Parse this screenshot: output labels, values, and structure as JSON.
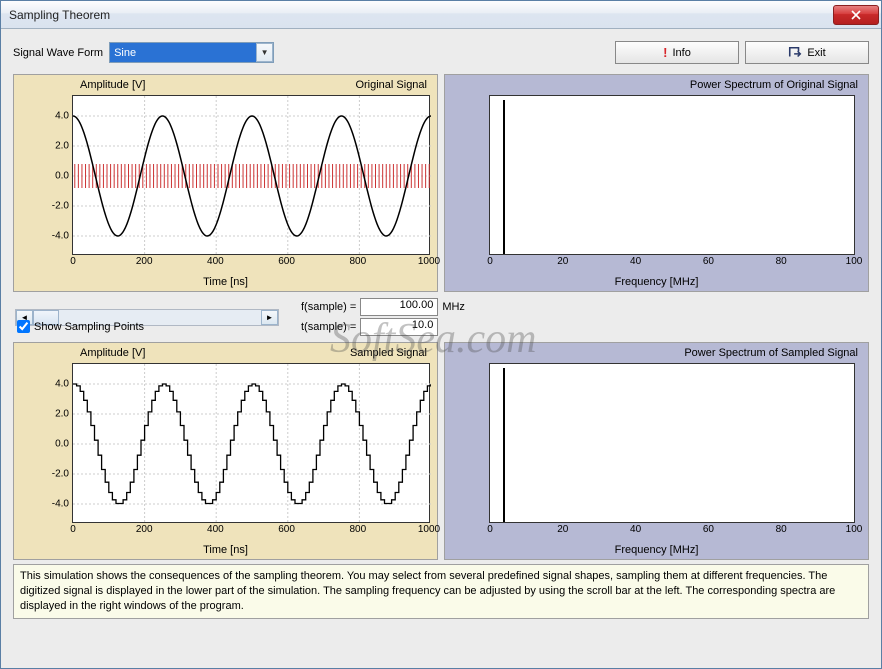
{
  "window": {
    "title": "Sampling Theorem"
  },
  "toolbar": {
    "signal_label": "Signal Wave Form",
    "signal_selected": "Sine",
    "info_label": "Info",
    "exit_label": "Exit"
  },
  "charts": {
    "original": {
      "ylabel": "Amplitude [V]",
      "title": "Original Signal",
      "xlabel": "Time [ns]"
    },
    "power_orig": {
      "title": "Power Spectrum of Original Signal",
      "xlabel": "Frequency [MHz]"
    },
    "sampled": {
      "ylabel": "Amplitude [V]",
      "title": "Sampled Signal",
      "xlabel": "Time [ns]"
    },
    "power_sampled": {
      "title": "Power Spectrum of Sampled Signal",
      "xlabel": "Frequency [MHz]"
    }
  },
  "chart_data": [
    {
      "type": "line",
      "name": "Original Signal",
      "x_range": [
        0,
        1000
      ],
      "y_range": [
        -4,
        4
      ],
      "xticks": [
        0,
        200,
        400,
        600,
        800,
        1000
      ],
      "yticks": [
        -4.0,
        -2.0,
        0.0,
        2.0,
        4.0
      ],
      "xlabel": "Time [ns]",
      "ylabel": "Amplitude [V]",
      "series": [
        {
          "name": "sine",
          "amplitude": 4.0,
          "period_ns": 250,
          "phase": 90
        }
      ],
      "overlay": {
        "name": "sampling_pulses",
        "count_approx": 100,
        "amplitude": 0.8
      }
    },
    {
      "type": "line",
      "name": "Power Spectrum of Original Signal",
      "x_range": [
        0,
        100
      ],
      "xticks": [
        0,
        20,
        40,
        60,
        80,
        100
      ],
      "xlabel": "Frequency [MHz]",
      "peaks": [
        {
          "x": 4,
          "y": 1.0
        }
      ]
    },
    {
      "type": "line",
      "name": "Sampled Signal",
      "x_range": [
        0,
        1000
      ],
      "y_range": [
        -4,
        4
      ],
      "xticks": [
        0,
        200,
        400,
        600,
        800,
        1000
      ],
      "yticks": [
        -4.0,
        -2.0,
        0.0,
        2.0,
        4.0
      ],
      "xlabel": "Time [ns]",
      "ylabel": "Amplitude [V]",
      "series": [
        {
          "name": "staircase-sine",
          "amplitude": 4.0,
          "period_ns": 250,
          "steps_per_period": 25
        }
      ]
    },
    {
      "type": "line",
      "name": "Power Spectrum of Sampled Signal",
      "x_range": [
        0,
        100
      ],
      "xticks": [
        0,
        20,
        40,
        60,
        80,
        100
      ],
      "xlabel": "Frequency [MHz]",
      "peaks": [
        {
          "x": 4,
          "y": 1.0
        }
      ]
    }
  ],
  "controls": {
    "fsample_label": "f(sample) =",
    "fsample_value": "100.00",
    "fsample_unit": "MHz",
    "tsample_label": "t(sample) =",
    "tsample_value": "10.0",
    "tsample_unit": "",
    "show_sampling_label": "Show Sampling Points",
    "show_sampling_checked": true
  },
  "footer": {
    "text": "This simulation shows the consequences of the sampling theorem. You may select from several predefined signal shapes, sampling them at different frequencies. The digitized signal is displayed in the lower part of the simulation. The sampling frequency can be adjusted by using the scroll bar at the left. The corresponding spectra are displayed in the right windows of the program."
  },
  "watermark": "SoftSea.com",
  "axis": {
    "amp_yticks": [
      "4.0",
      "2.0",
      "0.0",
      "-2.0",
      "-4.0"
    ],
    "time_xticks": [
      "0",
      "200",
      "400",
      "600",
      "800",
      "1000"
    ],
    "freq_xticks": [
      "0",
      "20",
      "40",
      "60",
      "80",
      "100"
    ]
  }
}
